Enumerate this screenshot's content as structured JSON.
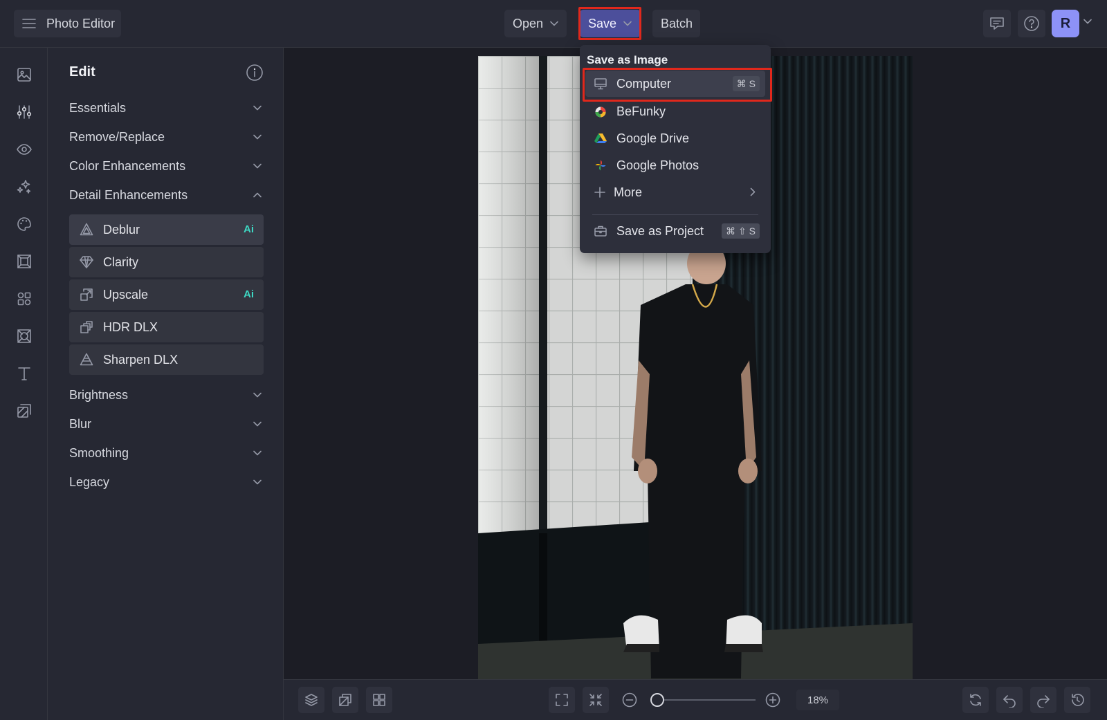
{
  "app": {
    "title": "Photo Editor"
  },
  "toolbar": {
    "open_label": "Open",
    "save_label": "Save",
    "batch_label": "Batch",
    "avatar_initial": "R"
  },
  "panel": {
    "title": "Edit",
    "sections_top": [
      "Essentials",
      "Remove/Replace",
      "Color Enhancements",
      "Detail Enhancements"
    ],
    "tools": [
      {
        "label": "Deblur",
        "badge": "Ai"
      },
      {
        "label": "Clarity",
        "badge": ""
      },
      {
        "label": "Upscale",
        "badge": "Ai"
      },
      {
        "label": "HDR DLX",
        "badge": ""
      },
      {
        "label": "Sharpen DLX",
        "badge": ""
      }
    ],
    "sections_bottom": [
      "Brightness",
      "Blur",
      "Smoothing",
      "Legacy"
    ]
  },
  "save_menu": {
    "heading": "Save as Image",
    "items": [
      {
        "label": "Computer",
        "shortcut": "⌘ S"
      },
      {
        "label": "BeFunky",
        "shortcut": ""
      },
      {
        "label": "Google Drive",
        "shortcut": ""
      },
      {
        "label": "Google Photos",
        "shortcut": ""
      },
      {
        "label": "More",
        "shortcut": ""
      }
    ],
    "project": {
      "label": "Save as Project",
      "shortcut": "⌘ ⇧ S"
    }
  },
  "zoom": {
    "label": "18%",
    "level": 0.18
  },
  "colors": {
    "accent": "#4c4f9b",
    "ai_badge": "#3ed9c4",
    "highlight_outline": "#e0281c",
    "avatar": "#8d92f7"
  }
}
